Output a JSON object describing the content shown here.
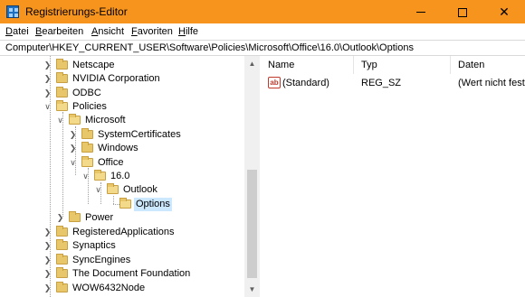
{
  "window": {
    "title": "Registrierungs-Editor",
    "min_icon": "minimize-icon",
    "max_icon": "maximize-icon",
    "close_icon": "close-icon"
  },
  "menu": {
    "items": [
      "Datei",
      "Bearbeiten",
      "Ansicht",
      "Favoriten",
      "Hilfe"
    ],
    "accelerators": [
      "D",
      "B",
      "A",
      "F",
      "H"
    ]
  },
  "address": "Computer\\HKEY_CURRENT_USER\\Software\\Policies\\Microsoft\\Office\\16.0\\Outlook\\Options",
  "tree": {
    "items": [
      {
        "label": "Netscape",
        "expanded": false
      },
      {
        "label": "NVIDIA Corporation",
        "expanded": false
      },
      {
        "label": "ODBC",
        "expanded": false
      },
      {
        "label": "Policies",
        "expanded": true
      },
      {
        "label": "Microsoft",
        "expanded": true
      },
      {
        "label": "SystemCertificates",
        "expanded": false
      },
      {
        "label": "Windows",
        "expanded": false
      },
      {
        "label": "Office",
        "expanded": true
      },
      {
        "label": "16.0",
        "expanded": true
      },
      {
        "label": "Outlook",
        "expanded": true
      },
      {
        "label": "Options",
        "expanded": false,
        "selected": true
      },
      {
        "label": "Power",
        "expanded": false
      },
      {
        "label": "RegisteredApplications",
        "expanded": false
      },
      {
        "label": "Synaptics",
        "expanded": false
      },
      {
        "label": "SyncEngines",
        "expanded": false
      },
      {
        "label": "The Document Foundation",
        "expanded": false
      },
      {
        "label": "WOW6432Node",
        "expanded": false
      }
    ]
  },
  "list": {
    "columns": [
      "Name",
      "Typ",
      "Daten"
    ],
    "rows": [
      {
        "name": "(Standard)",
        "type": "REG_SZ",
        "data": "(Wert nicht fest",
        "icon": "string-value-icon"
      }
    ]
  },
  "colors": {
    "titlebar": "#f7941d",
    "selection": "#cce8ff"
  }
}
